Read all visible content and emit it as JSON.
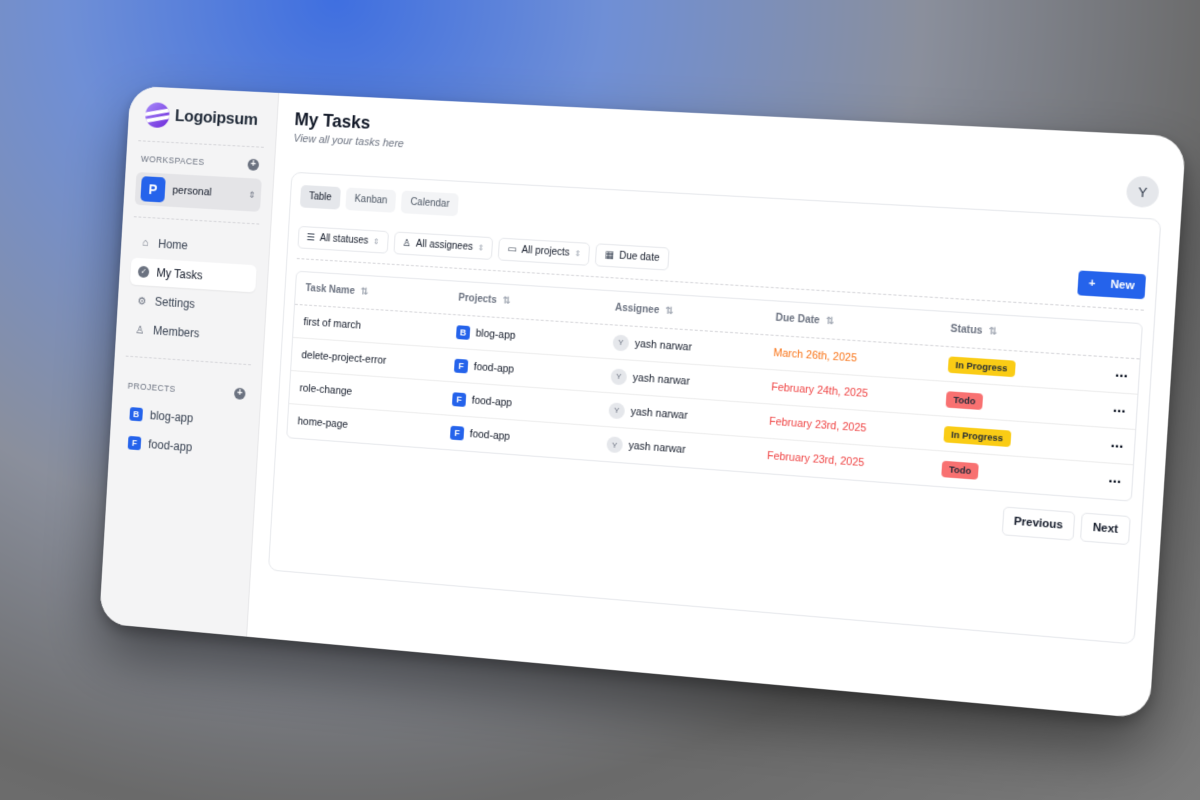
{
  "brand": {
    "name": "Logoipsum"
  },
  "sidebar": {
    "workspaces_label": "WORKSPACES",
    "workspace": {
      "initial": "P",
      "name": "personal"
    },
    "nav": [
      {
        "label": "Home",
        "icon": "home-icon"
      },
      {
        "label": "My Tasks",
        "icon": "check-circle-icon",
        "active": true
      },
      {
        "label": "Settings",
        "icon": "gear-icon"
      },
      {
        "label": "Members",
        "icon": "user-icon"
      }
    ],
    "projects_label": "PROJECTS",
    "projects": [
      {
        "initial": "B",
        "name": "blog-app"
      },
      {
        "initial": "F",
        "name": "food-app"
      }
    ]
  },
  "header": {
    "title": "My Tasks",
    "subtitle": "View all your tasks here",
    "user_initial": "Y"
  },
  "tabs": [
    {
      "label": "Table",
      "active": true
    },
    {
      "label": "Kanban"
    },
    {
      "label": "Calendar"
    }
  ],
  "filters": {
    "statuses": "All statuses",
    "assignees": "All assignees",
    "projects": "All projects",
    "due_date": "Due date"
  },
  "new_button": "New",
  "table": {
    "columns": [
      "Task Name",
      "Projects",
      "Assignee",
      "Due Date",
      "Status"
    ],
    "rows": [
      {
        "task": "first of march",
        "project_initial": "B",
        "project": "blog-app",
        "assignee_initial": "Y",
        "assignee": "yash narwar",
        "due": "March 26th, 2025",
        "status": "In Progress"
      },
      {
        "task": "delete-project-error",
        "project_initial": "F",
        "project": "food-app",
        "assignee_initial": "Y",
        "assignee": "yash narwar",
        "due": "February 24th, 2025",
        "status": "Todo"
      },
      {
        "task": "role-change",
        "project_initial": "F",
        "project": "food-app",
        "assignee_initial": "Y",
        "assignee": "yash narwar",
        "due": "February 23rd, 2025",
        "status": "In Progress"
      },
      {
        "task": "home-page",
        "project_initial": "F",
        "project": "food-app",
        "assignee_initial": "Y",
        "assignee": "yash narwar",
        "due": "February 23rd, 2025",
        "status": "Todo"
      }
    ]
  },
  "pagination": {
    "previous": "Previous",
    "next": "Next"
  },
  "colors": {
    "accent": "#2563eb",
    "in_progress": "#facc15",
    "todo": "#f87171",
    "due_text": "#ef4444"
  }
}
